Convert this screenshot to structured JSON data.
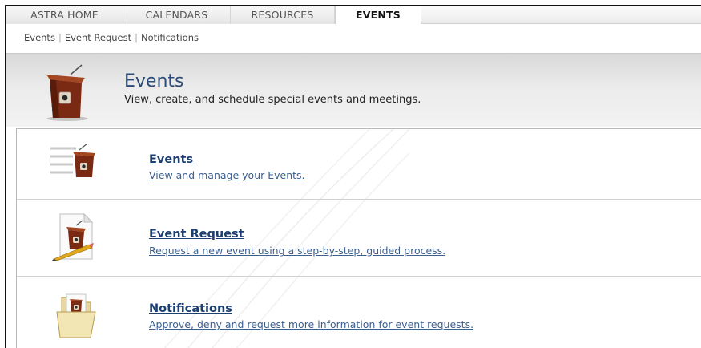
{
  "tabs": [
    {
      "label": "ASTRA HOME"
    },
    {
      "label": "CALENDARS"
    },
    {
      "label": "RESOURCES"
    },
    {
      "label": "EVENTS"
    }
  ],
  "subnav": {
    "items": [
      "Events",
      "Event Request",
      "Notifications"
    ],
    "separator": "|"
  },
  "header": {
    "title": "Events",
    "description": "View, create, and schedule special events and meetings.",
    "icon": "podium-icon"
  },
  "items": [
    {
      "label": "Events",
      "description": "View and manage your Events.",
      "icon": "podium-list-icon"
    },
    {
      "label": "Event Request",
      "description": "Request a new event using a step-by-step, guided process.",
      "icon": "podium-document-icon"
    },
    {
      "label": "Notifications",
      "description": "Approve, deny and request more information for event requests.",
      "icon": "podium-folder-icon"
    }
  ],
  "colors": {
    "title": "#2a4a78",
    "link": "#1b3f73",
    "podium": "#7a2a12"
  }
}
